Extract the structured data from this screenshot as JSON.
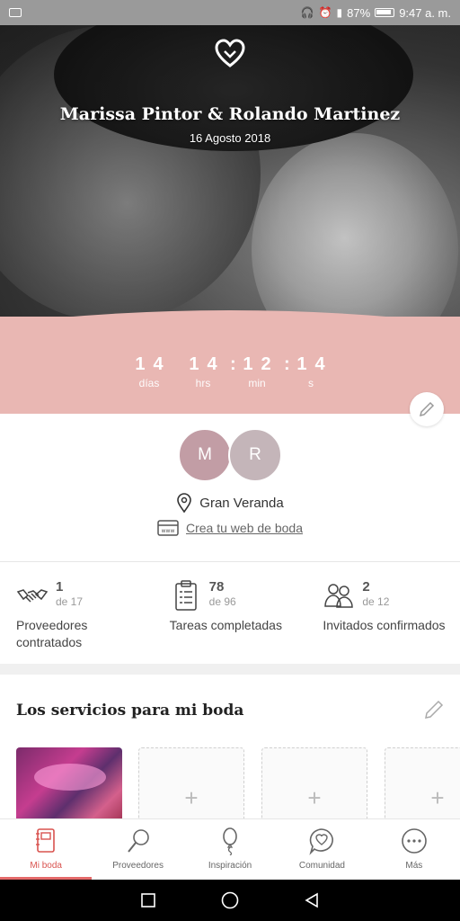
{
  "status_bar": {
    "battery": "87%",
    "time": "9:47 a. m."
  },
  "hero": {
    "couple_names": "Marissa Pintor & Rolando Martinez",
    "date": "16 Agosto 2018",
    "countdown": {
      "days": {
        "value": "14",
        "label": "días"
      },
      "hours": {
        "value": "14",
        "label": "hrs"
      },
      "minutes": {
        "value": "12",
        "label": "min"
      },
      "seconds": {
        "value": "14",
        "label": "s"
      }
    }
  },
  "profile": {
    "avatar_1": "M",
    "avatar_2": "R",
    "venue": "Gran Veranda",
    "web_link": "Crea tu web de boda"
  },
  "stats": [
    {
      "value": "1",
      "of": "de 17",
      "label": "Proveedores contratados",
      "icon": "handshake-icon"
    },
    {
      "value": "78",
      "of": "de 96",
      "label": "Tareas completadas",
      "icon": "checklist-icon"
    },
    {
      "value": "2",
      "of": "de 12",
      "label": "Invitados confirmados",
      "icon": "guests-icon"
    }
  ],
  "services": {
    "title": "Los servicios para mi boda",
    "add_symbol": "+"
  },
  "bottom_nav": [
    {
      "label": "Mi boda",
      "icon": "notebook-icon",
      "active": true
    },
    {
      "label": "Proveedores",
      "icon": "magnifier-icon",
      "active": false
    },
    {
      "label": "Inspiración",
      "icon": "balloon-icon",
      "active": false
    },
    {
      "label": "Comunidad",
      "icon": "chat-heart-icon",
      "active": false
    },
    {
      "label": "Más",
      "icon": "more-dots-icon",
      "active": false
    }
  ],
  "colors": {
    "accent_pink": "#e9b7b3",
    "active_nav": "#d9534f"
  }
}
